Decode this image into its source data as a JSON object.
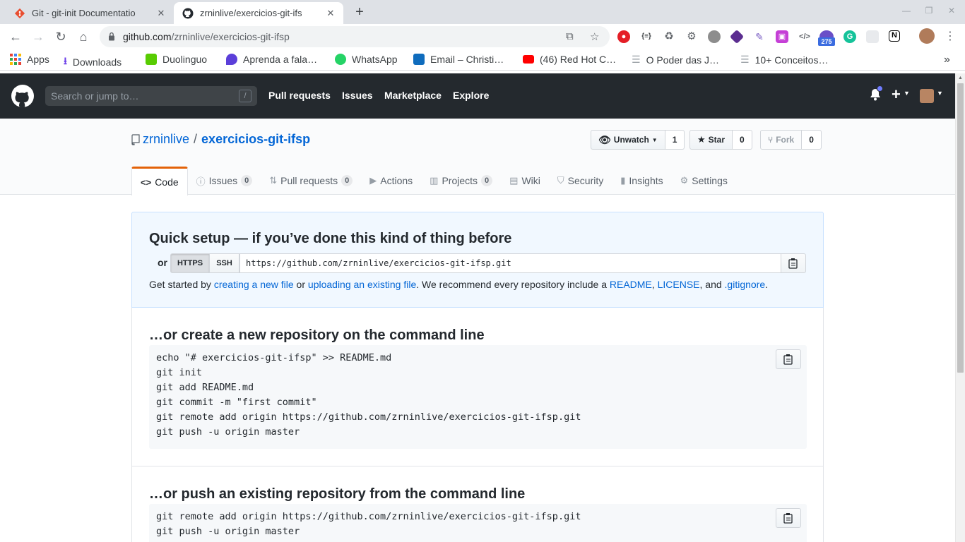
{
  "browser": {
    "tabs": [
      {
        "title": "Git - git-init Documentatio",
        "active": false
      },
      {
        "title": "zrninlive/exercicios-git-ifs",
        "active": true
      }
    ],
    "url_domain": "github.com",
    "url_path": "/zrninlive/exercicios-git-ifsp",
    "extension_badge": "275",
    "bookmarks": [
      {
        "label": "Apps",
        "color": "#4285f4"
      },
      {
        "label": "Downloads",
        "color": "#6a3de8"
      },
      {
        "label": "Duolinguo",
        "color": "#58cc02"
      },
      {
        "label": "Aprenda a fala…",
        "color": "#5b3fd9"
      },
      {
        "label": "WhatsApp",
        "color": "#25d366"
      },
      {
        "label": "Email – Christi…",
        "color": "#0f6cbd"
      },
      {
        "label": "(46) Red Hot C…",
        "color": "#ff0000"
      },
      {
        "label": "O Poder das J…",
        "color": "#9aa0a6"
      },
      {
        "label": "10+ Conceitos…",
        "color": "#9aa0a6"
      }
    ],
    "more_bookmarks": "»"
  },
  "github": {
    "search_placeholder": "Search or jump to…",
    "search_shortcut": "/",
    "nav": [
      "Pull requests",
      "Issues",
      "Marketplace",
      "Explore"
    ],
    "plus": "+",
    "accent_orange": "#e36209",
    "link_blue": "#0366d6"
  },
  "repo": {
    "owner": "zrninlive",
    "separator": "/",
    "name": "exercicios-git-ifsp",
    "watch_label": "Unwatch",
    "watch_count": "1",
    "star_label": "Star",
    "star_count": "0",
    "fork_label": "Fork",
    "fork_count": "0",
    "tabs": [
      {
        "label": "Code",
        "icon": "code-icon",
        "counter": null
      },
      {
        "label": "Issues",
        "icon": "issue-icon",
        "counter": "0"
      },
      {
        "label": "Pull requests",
        "icon": "pull-request-icon",
        "counter": "0"
      },
      {
        "label": "Actions",
        "icon": "play-icon",
        "counter": null
      },
      {
        "label": "Projects",
        "icon": "project-icon",
        "counter": "0"
      },
      {
        "label": "Wiki",
        "icon": "book-icon",
        "counter": null
      },
      {
        "label": "Security",
        "icon": "shield-icon",
        "counter": null
      },
      {
        "label": "Insights",
        "icon": "graph-icon",
        "counter": null
      },
      {
        "label": "Settings",
        "icon": "gear-icon",
        "counter": null
      }
    ]
  },
  "quick_setup": {
    "title": "Quick setup — if you’ve done this kind of thing before",
    "or": "or",
    "https": "HTTPS",
    "ssh": "SSH",
    "clone_url": "https://github.com/zrninlive/exercicios-git-ifsp.git",
    "note_1": "Get started by ",
    "link_new_file": "creating a new file",
    "note_2": " or ",
    "link_upload": "uploading an existing file",
    "note_3": ". We recommend every repository include a ",
    "link_readme": "README",
    "note_4": ", ",
    "link_license": "LICENSE",
    "note_5": ", and ",
    "link_gitignore": ".gitignore",
    "note_6": "."
  },
  "create_section": {
    "title": "…or create a new repository on the command line",
    "code": "echo \"# exercicios-git-ifsp\" >> README.md\ngit init\ngit add README.md\ngit commit -m \"first commit\"\ngit remote add origin https://github.com/zrninlive/exercicios-git-ifsp.git\ngit push -u origin master"
  },
  "push_section": {
    "title": "…or push an existing repository from the command line",
    "code": "git remote add origin https://github.com/zrninlive/exercicios-git-ifsp.git\ngit push -u origin master"
  }
}
